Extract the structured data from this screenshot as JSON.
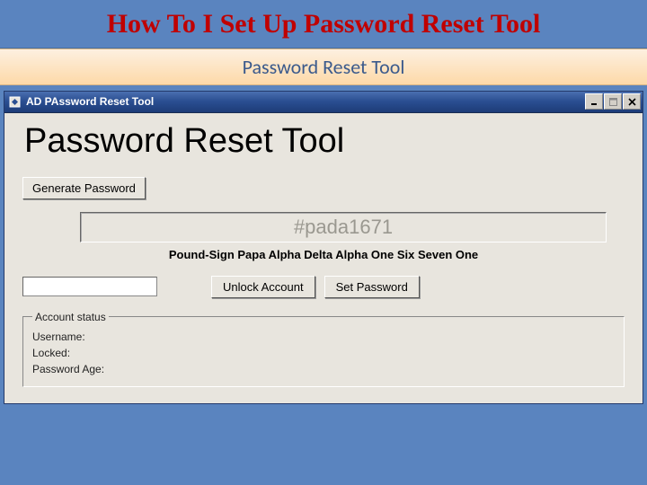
{
  "slide": {
    "title": "How To I Set Up Password Reset Tool",
    "subtitle": "Password Reset Tool"
  },
  "window": {
    "title": "AD PAssword Reset Tool",
    "controls": {
      "minimize": "_",
      "maximize": "□",
      "close": "×"
    }
  },
  "app": {
    "heading": "Password Reset Tool",
    "generate_button": "Generate Password",
    "password_value": "#pada1671",
    "phonetic": "Pound-Sign Papa Alpha Delta Alpha One Six Seven One",
    "username_value": "",
    "unlock_button": "Unlock Account",
    "set_password_button": "Set Password",
    "status": {
      "legend": "Account status",
      "username_label": "Username:",
      "locked_label": "Locked:",
      "password_age_label": "Password Age:"
    }
  }
}
